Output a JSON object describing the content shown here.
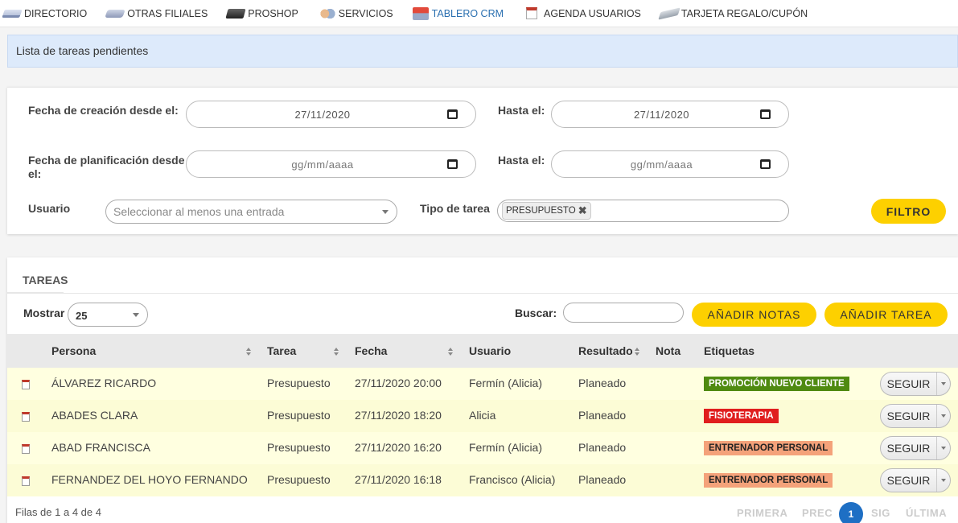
{
  "nav": {
    "items": [
      {
        "label": "DIRECTORIO",
        "icon": "directory-icon"
      },
      {
        "label": "OTRAS FILIALES",
        "icon": "branches-icon"
      },
      {
        "label": "PROSHOP",
        "icon": "proshop-icon"
      },
      {
        "label": "SERVICIOS",
        "icon": "handshake-icon"
      },
      {
        "label": "TABLERO CRM",
        "icon": "crm-board-icon"
      },
      {
        "label": "AGENDA USUARIOS",
        "icon": "calendar-icon"
      },
      {
        "label": "TARJETA REGALO/CUPÓN",
        "icon": "gift-card-icon"
      }
    ],
    "active_color": "#2a6fb0"
  },
  "banner": {
    "text": "Lista de tareas pendientes"
  },
  "filters": {
    "created_from_label": "Fecha de creación desde el:",
    "created_from_value": "27/11/2020",
    "created_to_label": "Hasta el:",
    "created_to_value": "27/11/2020",
    "planned_from_label": "Fecha de planificación desde el:",
    "planned_from_placeholder": "gg/mm/aaaa",
    "planned_to_label": "Hasta el:",
    "planned_to_placeholder": "gg/mm/aaaa",
    "user_label": "Usuario",
    "user_placeholder": "Seleccionar al menos una entrada",
    "task_type_label": "Tipo de tarea",
    "task_type_tag": "PRESUPUESTO",
    "filter_button": "FILTRO"
  },
  "tasks": {
    "title": "TAREAS",
    "show_label": "Mostrar",
    "show_value": "25",
    "search_label": "Buscar:",
    "add_notes_button": "AÑADIR NOTAS",
    "add_task_button": "AÑADIR TAREA",
    "columns": [
      "Persona",
      "Tarea",
      "Fecha",
      "Usuario",
      "Resultado",
      "Nota",
      "Etiquetas"
    ],
    "rows": [
      {
        "persona": "ÁLVAREZ RICARDO",
        "tarea": "Presupuesto",
        "fecha": "27/11/2020 20:00",
        "usuario": "Fermín (Alicia)",
        "resultado": "Planeado",
        "nota": "",
        "etiqueta": "PROMOCIÓN NUEVO CLIENTE",
        "etiqueta_color": "#4f8a10",
        "etiqueta_text_color": "#ffffff",
        "action": "SEGUIR"
      },
      {
        "persona": "ABADES CLARA",
        "tarea": "Presupuesto",
        "fecha": "27/11/2020 18:20",
        "usuario": "Alicia",
        "resultado": "Planeado",
        "nota": "",
        "etiqueta": "FISIOTERAPIA",
        "etiqueta_color": "#e01e1e",
        "etiqueta_text_color": "#ffffff",
        "action": "SEGUIR"
      },
      {
        "persona": "ABAD FRANCISCA",
        "tarea": "Presupuesto",
        "fecha": "27/11/2020 16:20",
        "usuario": "Fermín (Alicia)",
        "resultado": "Planeado",
        "nota": "",
        "etiqueta": "ENTRENADOR PERSONAL",
        "etiqueta_color": "#f4a27a",
        "etiqueta_text_color": "#222222",
        "action": "SEGUIR"
      },
      {
        "persona": "FERNANDEZ DEL HOYO FERNANDO",
        "tarea": "Presupuesto",
        "fecha": "27/11/2020 16:18",
        "usuario": "Francisco (Alicia)",
        "resultado": "Planeado",
        "nota": "",
        "etiqueta": "ENTRENADOR PERSONAL",
        "etiqueta_color": "#f4a27a",
        "etiqueta_text_color": "#222222",
        "action": "SEGUIR"
      }
    ],
    "footer_text": "Filas de 1 a 4 de 4",
    "pagination": {
      "first": "PRIMERA",
      "prev": "PREC",
      "current": "1",
      "next": "SIG",
      "last": "ÚLTIMA"
    }
  }
}
